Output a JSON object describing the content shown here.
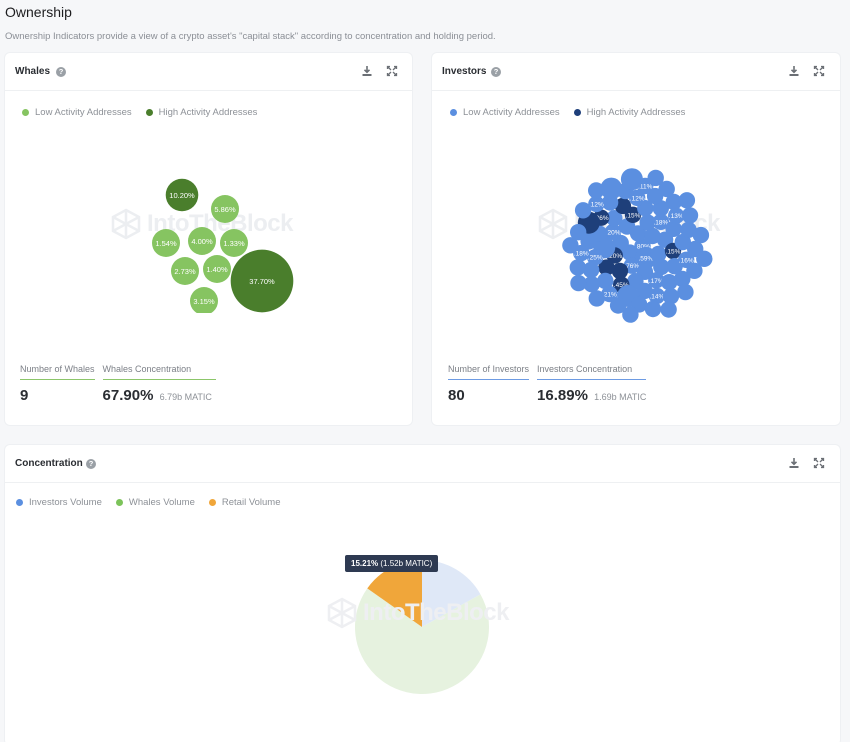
{
  "page": {
    "title": "Ownership",
    "subtitle": "Ownership Indicators provide a view of a crypto asset's \"capital stack\" according to concentration and holding period."
  },
  "watermark": "IntoTheBlock",
  "icons": {
    "help": "help-circle-icon",
    "download": "download-icon",
    "expand": "expand-icon"
  },
  "whales": {
    "title": "Whales",
    "legend": [
      {
        "label": "Low Activity Addresses",
        "color": "#86c461"
      },
      {
        "label": "High Activity Addresses",
        "color": "#4a7e2c"
      }
    ],
    "stats": {
      "count_label": "Number of Whales",
      "count_value": "9",
      "conc_label": "Whales Concentration",
      "conc_value": "67.90%",
      "conc_sub": "6.79b MATIC",
      "accent": "#8cc66a"
    }
  },
  "investors": {
    "title": "Investors",
    "legend": [
      {
        "label": "Low Activity Addresses",
        "color": "#5b8fe0"
      },
      {
        "label": "High Activity Addresses",
        "color": "#1e3f7a"
      }
    ],
    "stats": {
      "count_label": "Number of Investors",
      "count_value": "80",
      "conc_label": "Investors Concentration",
      "conc_value": "16.89%",
      "conc_sub": "1.69b MATIC",
      "accent": "#6d9be3"
    }
  },
  "concentration": {
    "title": "Concentration",
    "legend": [
      {
        "label": "Investors Volume",
        "color": "#5b8fe0"
      },
      {
        "label": "Whales Volume",
        "color": "#7cc35a"
      },
      {
        "label": "Retail Volume",
        "color": "#f0a63a"
      }
    ],
    "tooltip": {
      "pct": "15.21%",
      "detail": "(1.52b MATIC)"
    }
  },
  "chart_data": [
    {
      "type": "bubble",
      "title": "Whales",
      "series": [
        {
          "name": "High Activity Addresses",
          "values": [
            10.2,
            37.7
          ]
        },
        {
          "name": "Low Activity Addresses",
          "values": [
            5.86,
            1.54,
            4.0,
            1.33,
            2.73,
            1.4,
            3.15
          ]
        }
      ],
      "bubbles": [
        {
          "label": "10.20%",
          "value": 10.2,
          "group": "high"
        },
        {
          "label": "5.86%",
          "value": 5.86,
          "group": "low"
        },
        {
          "label": "1.54%",
          "value": 1.54,
          "group": "low"
        },
        {
          "label": "4.00%",
          "value": 4.0,
          "group": "low"
        },
        {
          "label": "1.33%",
          "value": 1.33,
          "group": "low"
        },
        {
          "label": "2.73%",
          "value": 2.73,
          "group": "low"
        },
        {
          "label": "1.40%",
          "value": 1.4,
          "group": "low"
        },
        {
          "label": "37.70%",
          "value": 37.7,
          "group": "high"
        },
        {
          "label": "3.15%",
          "value": 3.15,
          "group": "low"
        }
      ]
    },
    {
      "type": "bubble",
      "title": "Investors",
      "count": 80,
      "visible_labels": [
        "0.80%",
        "0.59%",
        "0.76%",
        "0.20%",
        "0.20%",
        "0.15%",
        "0.18%",
        "0.15%",
        "0.17%",
        "0.45%",
        "0.25%",
        "0.26%",
        "0.12%",
        "0.13%",
        "0.16%",
        "0.14%",
        "0.21%",
        "0.18%",
        "0.12%",
        "0.11%"
      ],
      "high_activity_count": 9
    },
    {
      "type": "pie",
      "title": "Concentration",
      "slices": [
        {
          "name": "Investors Volume",
          "value": 16.89,
          "color": "#dfe8f7"
        },
        {
          "name": "Whales Volume",
          "value": 67.9,
          "color": "#e6f2df"
        },
        {
          "name": "Retail Volume",
          "value": 15.21,
          "color": "#f0a63a",
          "highlighted": true
        }
      ]
    }
  ]
}
